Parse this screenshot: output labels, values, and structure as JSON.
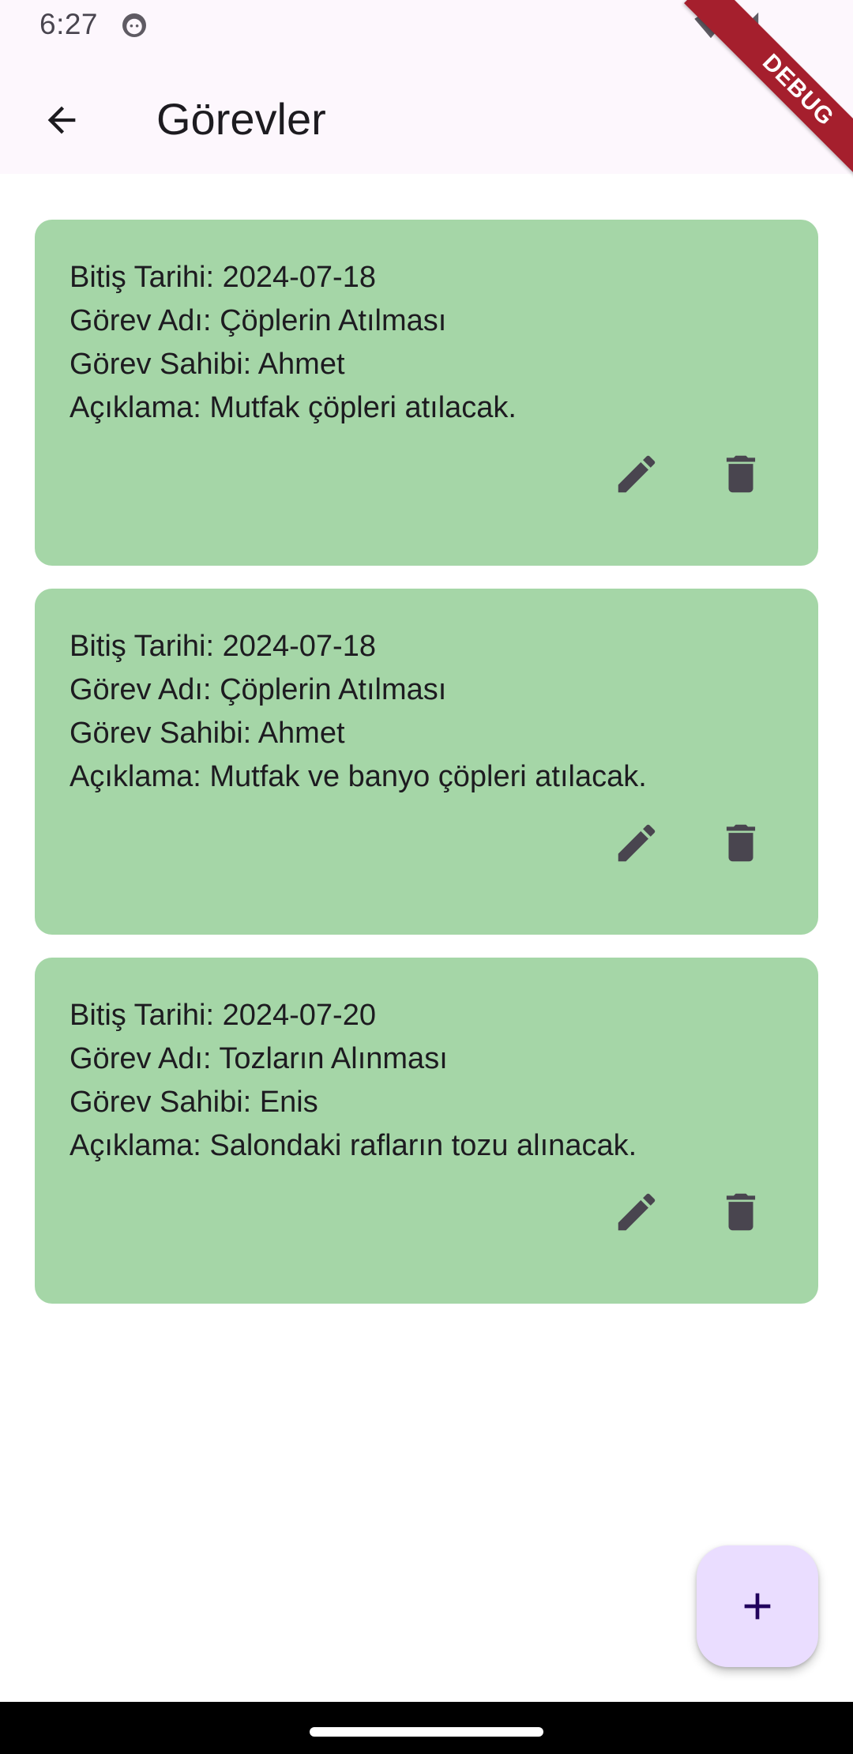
{
  "status_bar": {
    "time": "6:27",
    "icons": [
      "notification-face-icon",
      "wifi-icon",
      "cell-signal-icon"
    ]
  },
  "debug_banner": {
    "label": "DEBUG"
  },
  "app_bar": {
    "title": "Görevler",
    "back_icon": "arrow-back-icon"
  },
  "tasks": [
    {
      "due_date": "Bitiş Tarihi: 2024-07-18",
      "name": "Görev Adı: Çöplerin Atılması",
      "owner": "Görev Sahibi: Ahmet",
      "description": "Açıklama: Mutfak çöpleri atılacak.",
      "edit_icon": "pencil-icon",
      "delete_icon": "trash-icon"
    },
    {
      "due_date": "Bitiş Tarihi: 2024-07-18",
      "name": "Görev Adı: Çöplerin Atılması",
      "owner": "Görev Sahibi: Ahmet",
      "description": "Açıklama: Mutfak ve banyo çöpleri atılacak.",
      "edit_icon": "pencil-icon",
      "delete_icon": "trash-icon"
    },
    {
      "due_date": "Bitiş Tarihi: 2024-07-20",
      "name": "Görev Adı: Tozların Alınması",
      "owner": "Görev Sahibi: Enis",
      "description": "Açıklama: Salondaki rafların tozu alınacak.",
      "edit_icon": "pencil-icon",
      "delete_icon": "trash-icon"
    }
  ],
  "fab": {
    "icon": "plus-icon"
  },
  "colors": {
    "app_bar_bg": "#fdf7fd",
    "card_bg": "#a5d6a7",
    "fab_bg": "#eaddff",
    "icon_gray": "#49454f",
    "debug_red": "#a51f2d"
  }
}
